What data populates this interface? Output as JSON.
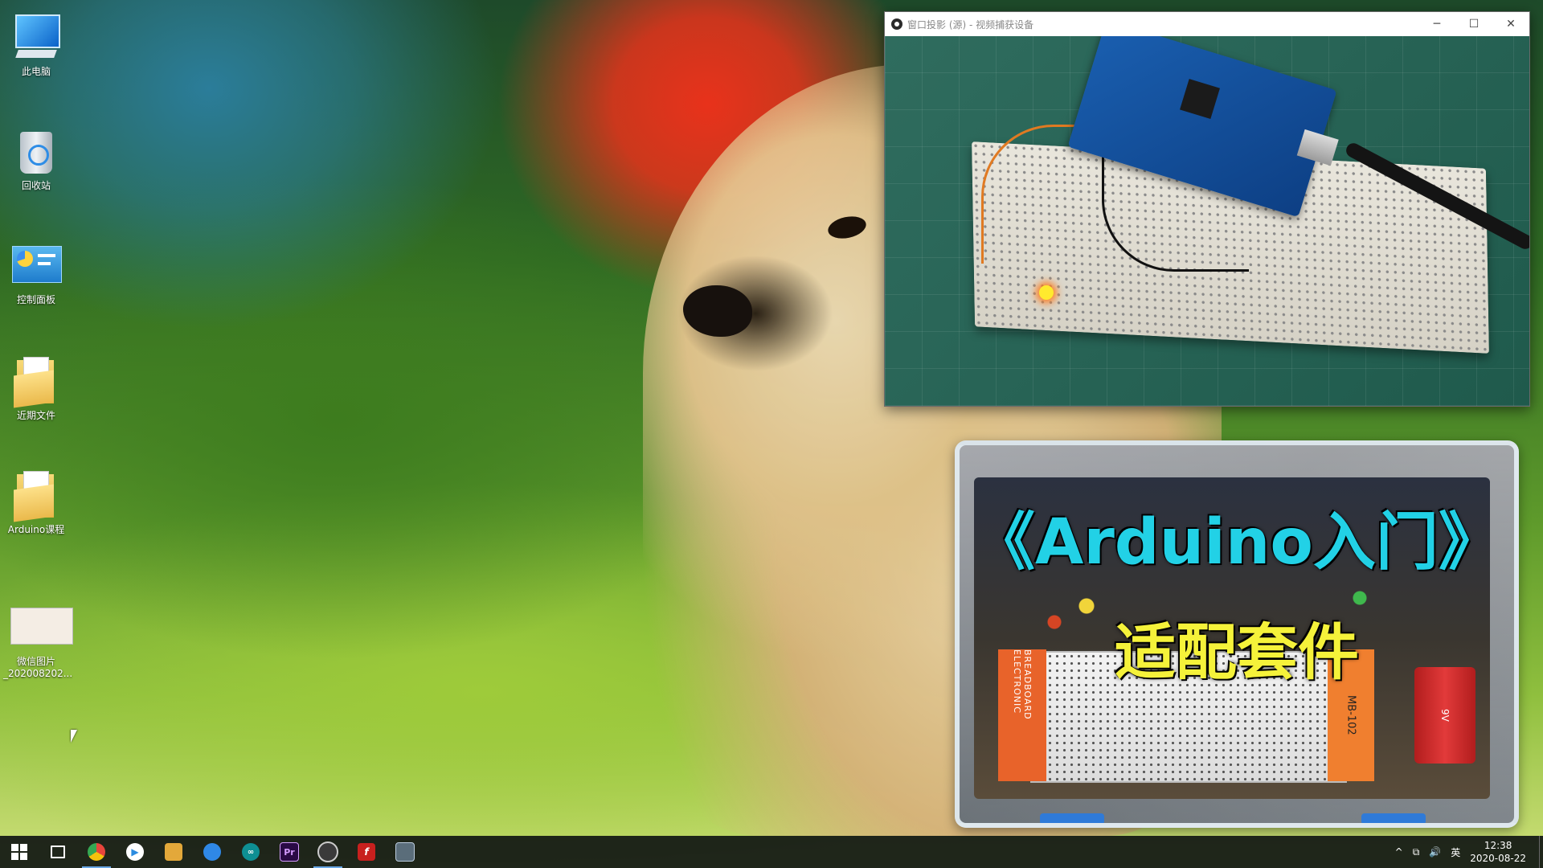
{
  "desktop": {
    "icons": [
      {
        "label": "此电脑",
        "icon": "this-pc-icon"
      },
      {
        "label": "回收站",
        "icon": "recycle-bin-icon"
      },
      {
        "label": "控制面板",
        "icon": "control-panel-icon"
      },
      {
        "label": "近期文件",
        "icon": "folder-icon"
      },
      {
        "label": "Arduino课程",
        "icon": "folder-icon"
      },
      {
        "label": "微信图片\n_202008202...",
        "icon": "image-thumbnail-icon"
      }
    ]
  },
  "projector_window": {
    "title": "窗口投影 (源) - 视频捕获设备",
    "controls": {
      "minimize": "─",
      "maximize": "☐",
      "close": "✕"
    }
  },
  "promo": {
    "title": "《Arduino入门》",
    "subtitle": "适配套件",
    "breadboard_label": "BREADBOARD ELECTRONIC",
    "mb_label": "MB-102",
    "battery_label": "9V"
  },
  "taskbar": {
    "apps": [
      {
        "name": "start",
        "icon": "windows-start-icon"
      },
      {
        "name": "task-view",
        "icon": "task-view-icon"
      },
      {
        "name": "chrome",
        "icon": "chrome-icon",
        "color": "#e8453c"
      },
      {
        "name": "media-player",
        "icon": "play-icon",
        "color": "#2b8ce0"
      },
      {
        "name": "file-manager",
        "icon": "folder-app-icon",
        "color": "#e3a83a"
      },
      {
        "name": "browser-blue",
        "icon": "browser-icon",
        "color": "#2f88e6"
      },
      {
        "name": "arduino-ide",
        "icon": "arduino-icon",
        "color": "#0e8f93"
      },
      {
        "name": "premiere",
        "icon": "premiere-icon",
        "color": "#2a0a45"
      },
      {
        "name": "obs",
        "icon": "obs-icon",
        "color": "#3a3a3a"
      },
      {
        "name": "flash",
        "icon": "flash-icon",
        "color": "#c8201e"
      },
      {
        "name": "remote-desktop",
        "icon": "monitor-icon",
        "color": "#5a6d7a"
      }
    ],
    "tray": {
      "chevron": "^",
      "network": "⧉",
      "volume": "🔊",
      "ime": "英",
      "time": "12:38",
      "date": "2020-08-22"
    }
  }
}
